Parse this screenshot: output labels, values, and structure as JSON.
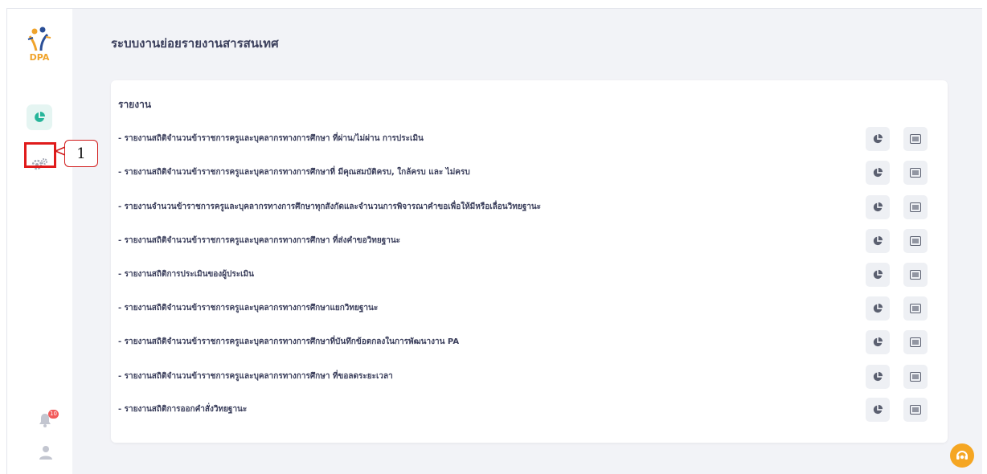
{
  "app": {
    "logo_text": "DPA",
    "page_title": "ระบบงานย่อยรายงานสารสนเทศ"
  },
  "sidebar": {
    "items": [
      {
        "name": "report",
        "icon": "pie-chart-icon",
        "active": true
      },
      {
        "name": "settings",
        "icon": "gears-icon",
        "active": false
      }
    ],
    "notification_count": "10",
    "active_color": "#26b59a"
  },
  "annotation": {
    "callout_label": "1",
    "color": "#e01b1b"
  },
  "card": {
    "title": "รายงาน",
    "reports": [
      {
        "label": "- รายงานสถิติจำนวนข้าราชการครูและบุคลากรทางการศึกษา ที่ผ่าน/ไม่ผ่าน การประเมิน"
      },
      {
        "label": "- รายงานสถิติจำนวนข้าราชการครูและบุคลากรทางการศึกษาที่ มีคุณสมบัติครบ, ใกล้ครบ และ ไม่ครบ"
      },
      {
        "label": "- รายงานจำนวนข้าราชการครูและบุคลากรทางการศึกษาทุกสังกัดและจำนวนการพิจารณาคำขอเพื่อให้มีหรือเลื่อนวิทยฐานะ"
      },
      {
        "label": "- รายงานสถิติจำนวนข้าราชการครูและบุคลากรทางการศึกษา ที่ส่งคำขอวิทยฐานะ"
      },
      {
        "label": "- รายงานสถิติการประเมินของผู้ประเมิน"
      },
      {
        "label": "- รายงานสถิติจำนวนข้าราชการครูและบุคลากรทางการศึกษาแยกวิทยฐานะ"
      },
      {
        "label": "- รายงานสถิติจำนวนข้าราชการครูและบุคลากรทางการศึกษาที่บันทึกข้อตกลงในการพัฒนางาน PA"
      },
      {
        "label": "- รายงานสถิติจำนวนข้าราชการครูและบุคลากรทางการศึกษา ที่ขอลดระยะเวลา"
      },
      {
        "label": "- รายงานสถิติการออกคำสั่งวิทยฐานะ"
      }
    ]
  },
  "help_button": {
    "icon": "headset-icon",
    "color": "#f5a623"
  }
}
